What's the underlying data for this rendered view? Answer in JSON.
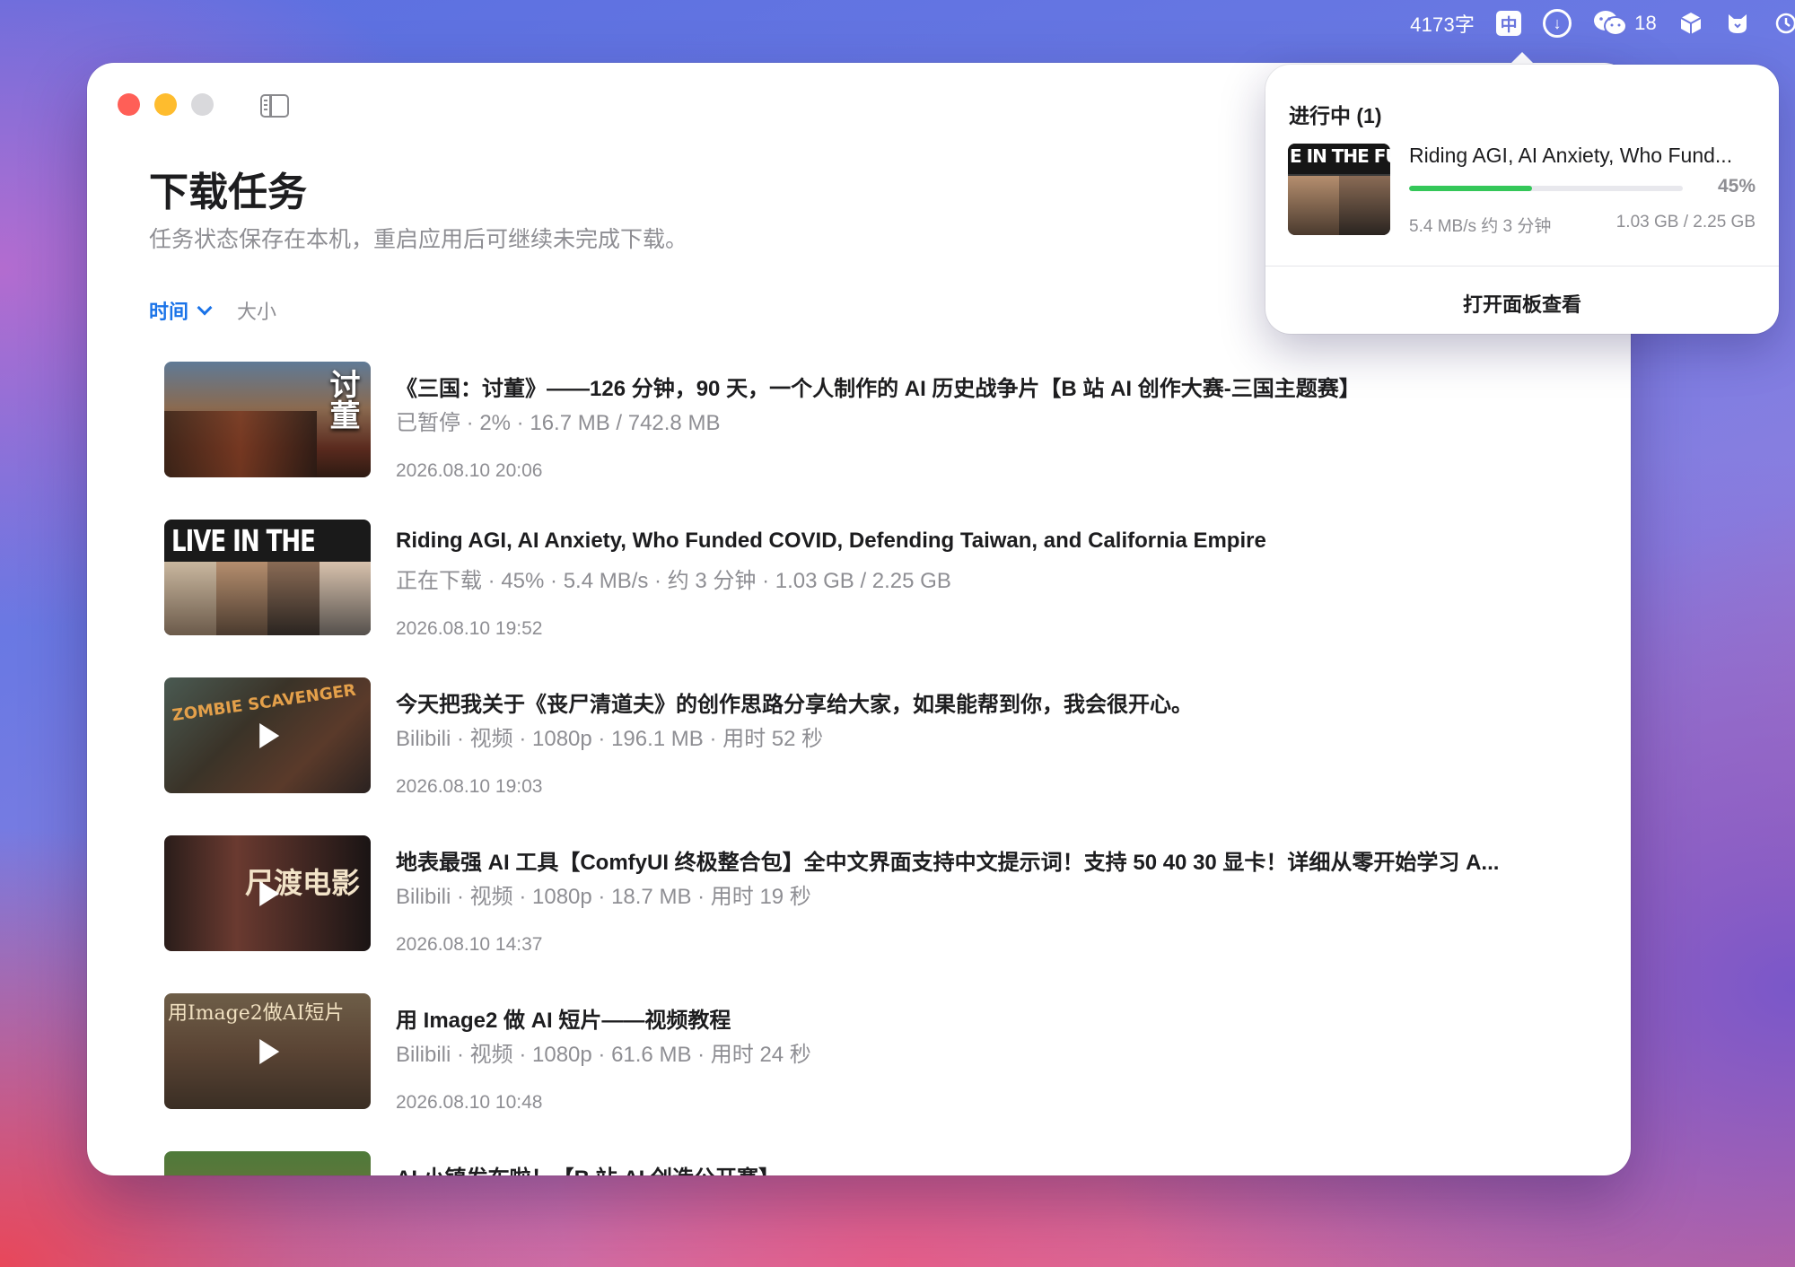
{
  "menubar": {
    "word_count": "4173字",
    "input_method": "中",
    "wechat_count": "18"
  },
  "page": {
    "title": "下载任务",
    "subtitle": "任务状态保存在本机，重启应用后可继续未完成下载。"
  },
  "sort": {
    "active": "时间",
    "inactive": "大小"
  },
  "items": [
    {
      "title": "《三国：讨董》——126 分钟，90 天，一个人制作的 AI 历史战争片【B 站 AI 创作大赛-三国主题赛】",
      "meta": "已暂停 · 2% · 16.7 MB / 742.8 MB",
      "date": "2026.08.10  20:06",
      "thumb_text": "讨董"
    },
    {
      "title": "Riding AGI, AI Anxiety, Who Funded COVID, Defending Taiwan, and California Empire",
      "meta": "正在下载 · 45% · 5.4 MB/s · 约 3 分钟 · 1.03 GB / 2.25 GB",
      "date": "2026.08.10  19:52",
      "thumb_text": "LIVE IN THE FUTURE"
    },
    {
      "title": "今天把我关于《丧尸清道夫》的创作思路分享给大家，如果能帮到你，我会很开心。",
      "meta": "Bilibili · 视频 · 1080p · 196.1 MB · 用时 52 秒",
      "date": "2026.08.10  19:03",
      "thumb_text": "ZOMBIE SCAVENGER"
    },
    {
      "title": "地表最强 AI 工具【ComfyUI 终极整合包】全中文界面支持中文提示词！支持 50 40 30 显卡！详细从零开始学习 A...",
      "meta": "Bilibili · 视频 · 1080p · 18.7 MB · 用时 19 秒",
      "date": "2026.08.10  14:37",
      "thumb_text": "尺渡电影"
    },
    {
      "title": "用 Image2 做 AI 短片——视频教程",
      "meta": "Bilibili · 视频 · 1080p · 61.6 MB · 用时 24 秒",
      "date": "2026.08.10  10:48",
      "thumb_text": "用Image2做AI短片"
    },
    {
      "title": "AI 小镇发布啦！【B 站 AI 创造公开赛】",
      "meta": "",
      "date": "",
      "thumb_text": ""
    }
  ],
  "popover": {
    "section": "进行中 (1)",
    "thumb_text": "E IN THE FUTU",
    "title": "Riding AGI, AI Anxiety, Who Fund...",
    "percent": "45%",
    "progress": 0.45,
    "speed": "5.4 MB/s 约 3 分钟",
    "size": "1.03 GB / 2.25 GB",
    "open_label": "打开面板查看"
  },
  "colors": {
    "accent": "#1a73e8",
    "progress": "#34c759",
    "close": "#ff5f57",
    "minimize": "#febc2e",
    "zoom_disabled": "#d9d9dc"
  }
}
